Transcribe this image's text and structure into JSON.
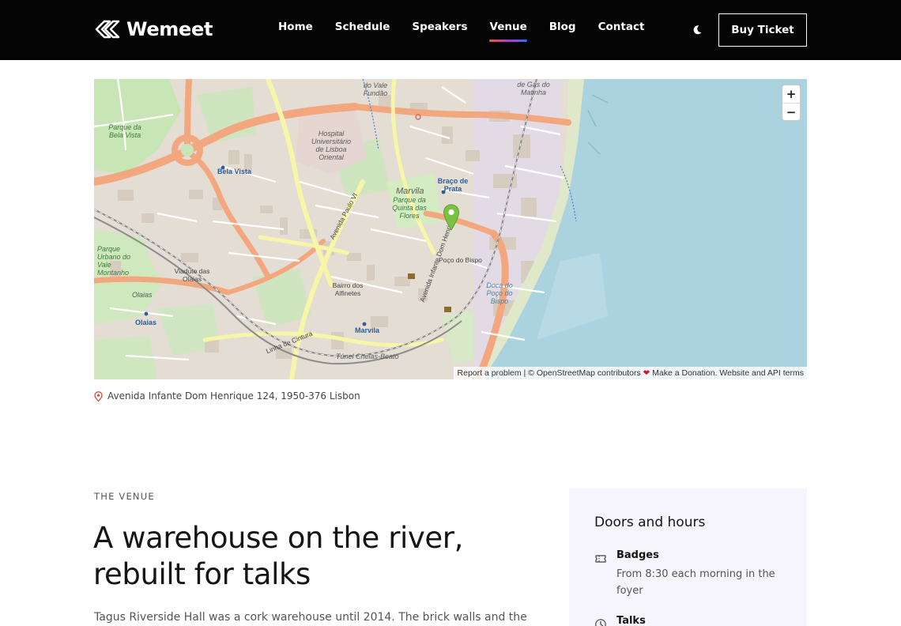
{
  "brand": {
    "name": "Wemeet",
    "logo_icon": "double-chevron-logo-icon"
  },
  "nav": {
    "items": [
      {
        "label": "Home",
        "active": false
      },
      {
        "label": "Schedule",
        "active": false
      },
      {
        "label": "Speakers",
        "active": false
      },
      {
        "label": "Venue",
        "active": true
      },
      {
        "label": "Blog",
        "active": false
      },
      {
        "label": "Contact",
        "active": false
      }
    ],
    "theme_icon": "moon-icon",
    "cta_label": "Buy Ticket"
  },
  "map": {
    "zoom_in": "+",
    "zoom_out": "−",
    "marker_icon": "map-pin-icon",
    "attribution": {
      "report": "Report a problem",
      "osm": "© OpenStreetMap contributors",
      "donation": "Make a Donation.",
      "terms": "Website and API terms"
    },
    "labels": {
      "parque_bela_vista": "Parque da Bela Vista",
      "bela_vista": "Bela Vista",
      "hospital": "Hospital Universitário de Lisboa Oriental",
      "marvila": "Marvila",
      "parque_quinta": "Parque da Quinta das Flores",
      "braco_prata": "Braço de Prata",
      "poco_bispo": "Poço do Bispo",
      "bairro_alfinetes": "Bairro dos Alfinetes",
      "olaias": "Olaias",
      "viaduto_olaias": "Viaduto das Olaias",
      "parque_urbano": "Parque Urbano do Vale Montanho",
      "doca_poco": "Doca do Poço do Bispo",
      "gas_matinha": "de Gás do Matinha",
      "avenida_infante": "Avenida Infante Dom Henrique",
      "avenida_paulo_vi": "Avenida Paulo VI",
      "marvila_station": "Marvila",
      "tunel_chelas": "Túnel Chelas-Beato",
      "linha_cintura": "Linha de Cintura",
      "do_vale_fundao": "do Vale Fundão"
    },
    "colors": {
      "water": "#aad3df",
      "land": "#e9e4dc",
      "park": "#c8e6b5",
      "major_road": "#f2a77e",
      "secondary_road": "#f7f6a8",
      "building": "#d9d0c6",
      "marker": "#7cc242"
    }
  },
  "address": {
    "icon": "location-pin-icon",
    "text": "Avenida Infante Dom Henrique 124, 1950-376 Lisbon"
  },
  "venue": {
    "eyebrow": "THE VENUE",
    "headline": "A warehouse on the river, rebuilt for talks",
    "body": "Tagus Riverside Hall was a cork warehouse until 2014. The brick walls and the long"
  },
  "hours": {
    "title": "Doors and hours",
    "items": [
      {
        "icon": "ticket-icon",
        "label": "Badges",
        "desc": "From 8:30 each morning in the foyer"
      },
      {
        "icon": "clock-icon",
        "label": "Talks",
        "desc": ""
      }
    ]
  }
}
